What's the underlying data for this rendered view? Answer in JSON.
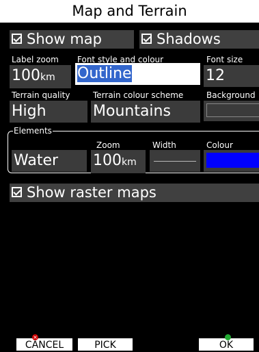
{
  "title": "Map and Terrain",
  "show_map": {
    "label": "Show map",
    "checked": true
  },
  "shadows": {
    "label": "Shadows",
    "checked": true
  },
  "label_zoom": {
    "label": "Label zoom",
    "value": "100",
    "unit": "km"
  },
  "font_style": {
    "label": "Font style and colour",
    "value": "Outline"
  },
  "font_size": {
    "label": "Font size",
    "value": "12"
  },
  "terrain_quality": {
    "label": "Terrain quality",
    "value": "High"
  },
  "terrain_colour": {
    "label": "Terrain colour scheme",
    "value": "Mountains"
  },
  "background": {
    "label": "Background",
    "value": ""
  },
  "elements": {
    "group_label": "Elements",
    "zoom_label": "Zoom",
    "width_label": "Width",
    "colour_label": "Colour",
    "name": "Water",
    "zoom_value": "100",
    "zoom_unit": "km",
    "colour": "#0000ff"
  },
  "show_raster": {
    "label": "Show raster maps",
    "checked": true
  },
  "buttons": {
    "cancel": "CANCEL",
    "pick": "PICK",
    "ok": "OK"
  },
  "colors": {
    "field_bg": "#3b3b3b",
    "bar_bg": "#404040",
    "highlight": "#3366cc"
  }
}
